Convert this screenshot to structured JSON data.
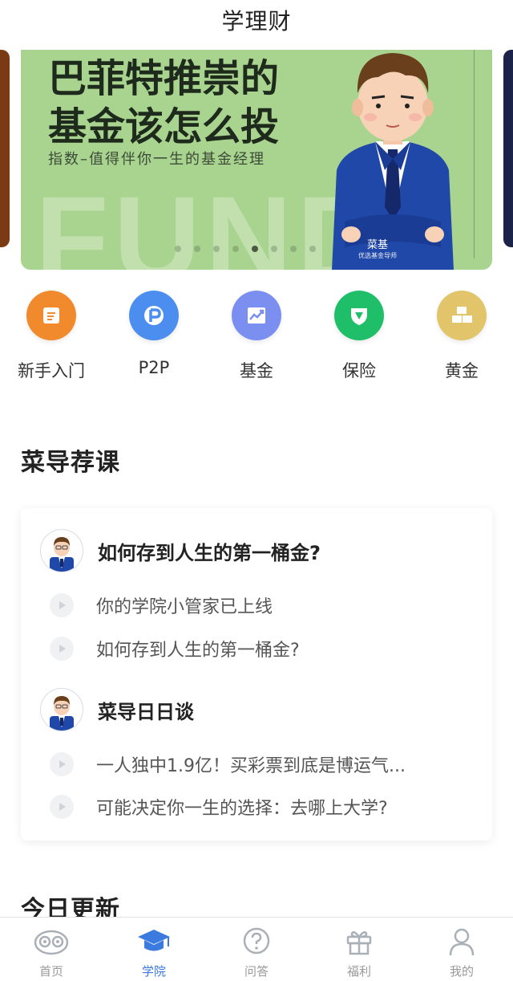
{
  "header": {
    "title": "学理财"
  },
  "banner": {
    "title_line1": "巴菲特推崇的",
    "title_line2": "基金该怎么投",
    "subtitle": "指数–值得伴你一生的基金经理",
    "bg_word": "FUND",
    "badge_name": "菜基",
    "badge_role": "优选基金导师",
    "slide_count": 8,
    "active_slide": 5,
    "color": "#a9d48f"
  },
  "quick_nav": [
    {
      "label": "新手入门",
      "icon": "beginner-icon",
      "color": "#f08a2c"
    },
    {
      "label": "P2P",
      "icon": "p2p-icon",
      "color": "#4c8ef0"
    },
    {
      "label": "基金",
      "icon": "fund-chart-icon",
      "color": "#7b8ff0"
    },
    {
      "label": "保险",
      "icon": "insurance-shield-icon",
      "color": "#1fbf6a"
    },
    {
      "label": "黄金",
      "icon": "gold-bars-icon",
      "color": "#e2c46a"
    }
  ],
  "sections": {
    "courses_title": "菜导荐课",
    "today_title": "今日更新"
  },
  "courses": [
    {
      "title": "如何存到人生的第一桶金?",
      "lessons": [
        "你的学院小管家已上线",
        "如何存到人生的第一桶金?"
      ]
    },
    {
      "title": "菜导日日谈",
      "lessons": [
        "一人独中1.9亿！买彩票到底是博运气...",
        "可能决定你一生的选择：去哪上大学?"
      ]
    }
  ],
  "tabbar": {
    "active_color": "#3b7be0",
    "items": [
      {
        "label": "首页",
        "icon": "owl-home-icon"
      },
      {
        "label": "学院",
        "icon": "graduation-cap-icon",
        "active": true
      },
      {
        "label": "问答",
        "icon": "question-bubble-icon"
      },
      {
        "label": "福利",
        "icon": "gift-icon"
      },
      {
        "label": "我的",
        "icon": "user-icon"
      }
    ]
  }
}
